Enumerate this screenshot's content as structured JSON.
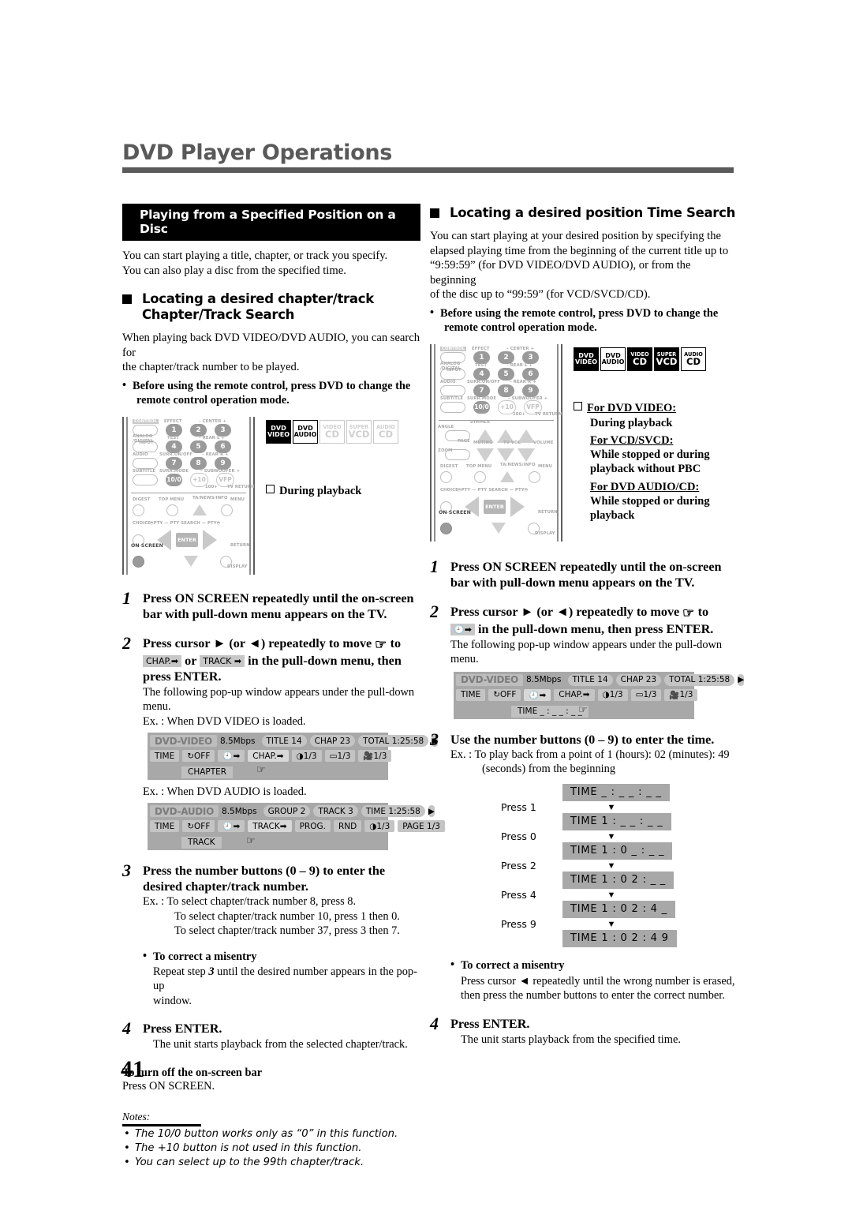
{
  "page": {
    "title": "DVD Player Operations",
    "folio": "41"
  },
  "left": {
    "section_bar": "Playing from a Specified Position on a Disc",
    "intro_line1": "You can start playing a title, chapter, or track you specify.",
    "intro_line2": "You can also play a disc from the specified time.",
    "subhead_line1": "Locating a desired chapter/track",
    "subhead_line2": "Chapter/Track Search",
    "desc_line1": "When playing back DVD VIDEO/DVD AUDIO, you can search for",
    "desc_line2": "the chapter/track number to be played.",
    "bullet_line1": "Before using the remote control, press DVD to change the",
    "bullet_line2": "remote control operation mode.",
    "condition": "During playback",
    "discs": [
      {
        "t1": "DVD",
        "t2": "VIDEO",
        "state": "inverted"
      },
      {
        "t1": "DVD",
        "t2": "AUDIO",
        "state": "outline"
      },
      {
        "t1": "VIDEO",
        "t2": "CD",
        "state": "disabled"
      },
      {
        "t1": "SUPER",
        "t2": "VCD",
        "state": "disabled"
      },
      {
        "t1": "AUDIO",
        "t2": "CD",
        "state": "disabled"
      }
    ],
    "steps": [
      {
        "num": "1",
        "head_l1": "Press ON SCREEN repeatedly until the on-screen",
        "head_l2": "bar with pull-down menu appears on the TV."
      },
      {
        "num": "2",
        "head_a": "Press cursor ► (or ◄) repeatedly to move",
        "head_b": "to",
        "key1": "CHAP.➡",
        "key_or": "or",
        "key2": "TRACK ➡",
        "head_c": "in the pull-down menu, then",
        "head_d": "press ENTER.",
        "sub_l1": "The following pop-up window appears under the pull-down",
        "sub_l2": "menu.",
        "ex1": "Ex. : When DVD VIDEO is loaded.",
        "ex2": "Ex. : When DVD AUDIO is loaded."
      },
      {
        "num": "3",
        "head_l1": "Press the number buttons (0 – 9) to enter the",
        "head_l2": "desired chapter/track number.",
        "ex_l1": "Ex. : To select chapter/track number 8, press 8.",
        "ex_l2": "To select chapter/track number 10, press 1 then 0.",
        "ex_l3": "To select chapter/track number 37, press 3 then 7.",
        "misentry_head": "To correct a misentry",
        "misentry_l1a": "Repeat step",
        "misentry_num": "3",
        "misentry_l1b": "until the desired number appears in the pop-up",
        "misentry_l2": "window."
      },
      {
        "num": "4",
        "head_l1": "Press ENTER.",
        "sub_l1": "The unit starts playback from the selected chapter/track."
      }
    ],
    "turn_off_head": "To turn off the on-screen bar",
    "turn_off_sub": "Press ON SCREEN.",
    "notes_label": "Notes:",
    "notes": [
      "The 10/0 button works only as “0” in this function.",
      "The +10 button is not used in this function.",
      "You can select up to the 99th chapter/track."
    ],
    "osb_video": {
      "name": "DVD-VIDEO",
      "bitrate": "8.5Mbps",
      "title": "TITLE 14",
      "chap": "CHAP 23",
      "total": "TOTAL 1:25:58",
      "row2": [
        "TIME",
        "OFF",
        "CHAP.",
        "1/3",
        "1/3",
        "1/3"
      ],
      "dropdown": "CHAPTER"
    },
    "osb_audio": {
      "name": "DVD-AUDIO",
      "bitrate": "8.5Mbps",
      "group": "GROUP 2",
      "track": "TRACK 3",
      "time": "TIME 1:25:58",
      "row2": [
        "TIME",
        "OFF",
        "TRACK",
        "PROG.",
        "RND",
        "1/3",
        "PAGE 1/3"
      ],
      "dropdown": "TRACK"
    }
  },
  "right": {
    "subhead": "Locating a desired position   Time Search",
    "desc_l1": "You can start playing at your desired position by specifying the",
    "desc_l2": "elapsed playing time from the beginning of the current title up to",
    "desc_l3": "“9:59:59” (for DVD VIDEO/DVD AUDIO), or from the beginning",
    "desc_l4": "of the disc up to “99:59” (for VCD/SVCD/CD).",
    "bullet_line1": "Before using the remote control, press DVD to change the",
    "bullet_line2": "remote control operation mode.",
    "discs": [
      {
        "t1": "DVD",
        "t2": "VIDEO",
        "state": "inverted"
      },
      {
        "t1": "DVD",
        "t2": "AUDIO",
        "state": "outline"
      },
      {
        "t1": "VIDEO",
        "t2": "CD",
        "state": "inverted"
      },
      {
        "t1": "SUPER",
        "t2": "VCD",
        "state": "inverted"
      },
      {
        "t1": "AUDIO",
        "t2": "CD",
        "state": "outline"
      }
    ],
    "conditions": [
      {
        "head": "For DVD VIDEO:",
        "body_l1": "During playback",
        "body_l2": ""
      },
      {
        "head": "For VCD/SVCD:",
        "body_l1": "While stopped or during",
        "body_l2": "playback without PBC"
      },
      {
        "head": "For DVD AUDIO/CD:",
        "body_l1": "While stopped or during",
        "body_l2": "playback"
      }
    ],
    "steps": [
      {
        "num": "1",
        "head_l1": "Press ON SCREEN repeatedly until the on-screen",
        "head_l2": "bar with pull-down menu appears on the TV."
      },
      {
        "num": "2",
        "head_a": "Press cursor ► (or ◄) repeatedly to move",
        "head_b": "to",
        "head_c": "in the pull-down menu, then press ENTER.",
        "sub_l1": "The following pop-up window appears under the pull-down",
        "sub_l2": "menu."
      },
      {
        "num": "3",
        "head_l1": "Use the number buttons (0 – 9) to enter the time.",
        "ex_l1": "Ex. : To play back from a point of  1 (hours): 02 (minutes): 49",
        "ex_l2": "(seconds) from the beginning",
        "misentry_head": "To correct a misentry",
        "misentry_l1": "Press cursor ◄ repeatedly until the wrong number is erased,",
        "misentry_l2": "then press the number buttons to enter the correct number."
      },
      {
        "num": "4",
        "head_l1": "Press ENTER.",
        "sub_l1": "The unit starts playback from the specified time."
      }
    ],
    "osb_video": {
      "name": "DVD-VIDEO",
      "bitrate": "8.5Mbps",
      "title": "TITLE 14",
      "chap": "CHAP 23",
      "total": "TOTAL 1:25:58",
      "row2": [
        "TIME",
        "OFF",
        "CHAP.",
        "1/3",
        "1/3",
        "1/3"
      ],
      "dropdown": "TIME  _ : _ _ : _ _"
    },
    "time_sequence": {
      "steps": [
        {
          "press": "",
          "display": "TIME _ : _ _ : _ _"
        },
        {
          "press": "Press 1",
          "display": "TIME 1 : _ _ : _ _"
        },
        {
          "press": "Press 0",
          "display": "TIME 1 : 0 _ : _ _"
        },
        {
          "press": "Press 2",
          "display": "TIME 1 : 0 2 : _ _"
        },
        {
          "press": "Press 4",
          "display": "TIME 1 : 0 2 : 4 _"
        },
        {
          "press": "Press 9",
          "display": "TIME 1 : 0 2 : 4 9"
        }
      ]
    }
  },
  "remote_labels": {
    "control": "CONTROL",
    "effect": "EFFECT",
    "center": "– CENTER +",
    "analog_digital": "ANALOG\n/DIGITAL",
    "input": "INPUT",
    "test": "TEST",
    "rear_l": "– REAR·L +",
    "audio": "AUDIO",
    "surr_onoff": "SURR.ON/OFF",
    "rear_r": "– REAR·R +",
    "subtitle": "SUBTITLE",
    "surr_mode": "SURR.MODE",
    "subwoofer": "– SUBWOOFER +",
    "n100": "100+",
    "tv_return": "TV RETURN",
    "vfp": "VFP",
    "plus10": "+10",
    "ten_zero": "10/0",
    "angle": "ANGLE",
    "dimmer": "DIMMER",
    "tv_vol": "TV VOL",
    "volume": "VOLUME",
    "zoom": "ZOOM",
    "page": "PAGE",
    "muting": "MUTING",
    "digest": "DIGEST",
    "top_menu": "TOP MENU",
    "ta_news_info": "TA/NEWS/INFO",
    "menu": "MENU",
    "choice": "CHOICE",
    "pty_search": "PTY — PTY SEARCH — PTY",
    "enter": "ENTER",
    "on_screen": "ON SCREEN",
    "return": "RETURN",
    "display": "DISPLAY",
    "digits": [
      "1",
      "2",
      "3",
      "4",
      "5",
      "6",
      "7",
      "8",
      "9"
    ]
  }
}
